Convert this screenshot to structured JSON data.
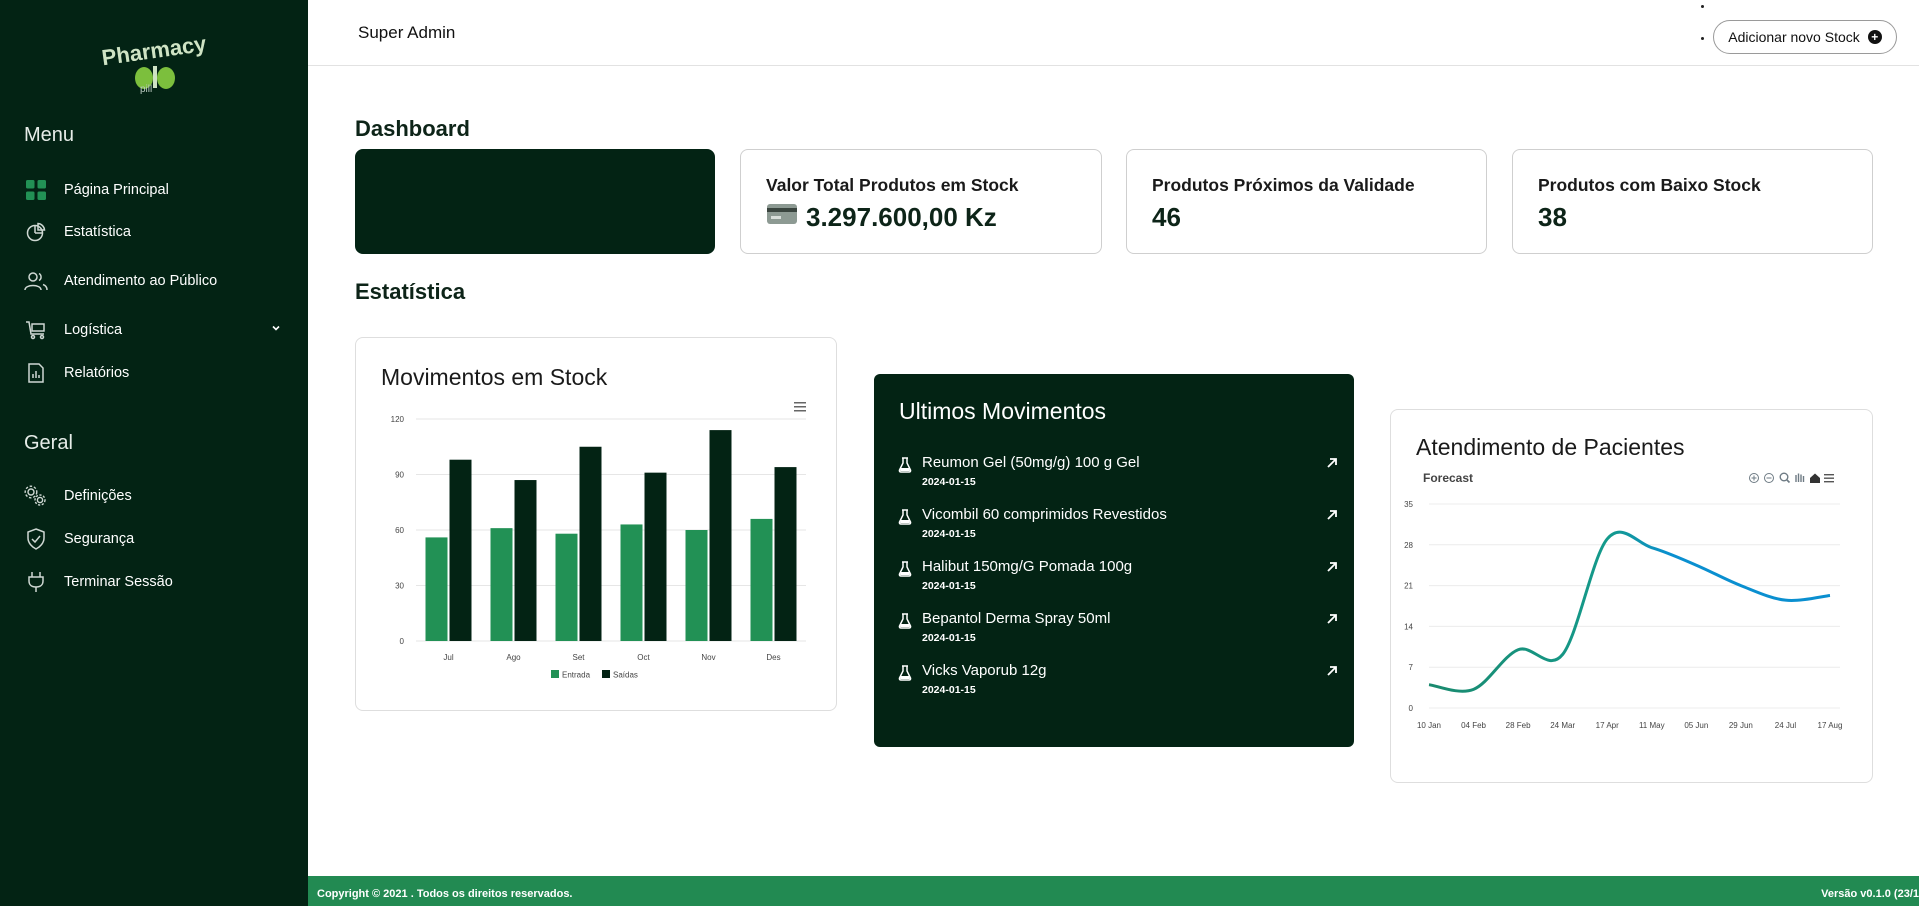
{
  "colors": {
    "sidebar_bg": "#032314",
    "accent_green": "#228a52",
    "bar_entrada": "#229155",
    "bar_saidas": "#032314",
    "line": "#0a8fd0",
    "link": "#0d8ff0"
  },
  "sidebar": {
    "logo_text": "Pharmacy",
    "logo_sub": "pill",
    "menu_title": "Menu",
    "menu_items": [
      {
        "label": "Página Principal",
        "icon": "grid-icon"
      },
      {
        "label": "Estatística",
        "icon": "pie-chart-icon"
      },
      {
        "label": "Atendimento ao Público",
        "icon": "users-icon"
      },
      {
        "label": "Logística",
        "icon": "cart-icon",
        "has_submenu": true
      },
      {
        "label": "Relatórios",
        "icon": "report-icon"
      }
    ],
    "general_title": "Geral",
    "general_items": [
      {
        "label": "Definições",
        "icon": "gears-icon"
      },
      {
        "label": "Segurança",
        "icon": "shield-icon"
      },
      {
        "label": "Terminar Sessão",
        "icon": "plug-icon"
      }
    ]
  },
  "topbar": {
    "user": "Super Admin",
    "add_stock_label": "Adicionar novo Stock"
  },
  "dashboard": {
    "title": "Dashboard",
    "cards": [
      {
        "label": "Valor Total Produtos em Stock",
        "value": "3.297.600,00 Kz",
        "icon": "credit-card-icon"
      },
      {
        "label": "Produtos Próximos da Validade",
        "value": "46"
      },
      {
        "label": "Produtos com Baixo Stock",
        "value": "38"
      }
    ]
  },
  "stats": {
    "title": "Estatística",
    "stock_chart_title": "Movimentos em Stock",
    "last_moves_title": "Ultimos Movimentos",
    "patients_title": "Atendimento de Pacientes"
  },
  "last_moves": [
    {
      "name": "Reumon Gel (50mg/g) 100 g Gel",
      "date": "2024-01-15"
    },
    {
      "name": "Vicombil 60 comprimidos Revestidos",
      "date": "2024-01-15"
    },
    {
      "name": "Halibut 150mg/G Pomada 100g",
      "date": "2024-01-15"
    },
    {
      "name": "Bepantol Derma Spray 50ml",
      "date": "2024-01-15"
    },
    {
      "name": "Vicks Vaporub 12g",
      "date": "2024-01-15"
    }
  ],
  "chart_data": [
    {
      "type": "bar",
      "title": "Movimentos em Stock",
      "categories": [
        "Jul",
        "Ago",
        "Set",
        "Oct",
        "Nov",
        "Des"
      ],
      "series": [
        {
          "name": "Entrada",
          "values": [
            56,
            61,
            58,
            63,
            60,
            66
          ]
        },
        {
          "name": "Saídas",
          "values": [
            98,
            87,
            105,
            91,
            114,
            94
          ]
        }
      ],
      "yticks": [
        0,
        30,
        60,
        90,
        120
      ],
      "ylim": [
        0,
        120
      ],
      "grid": true,
      "legend": "bottom"
    },
    {
      "type": "line",
      "title": "Atendimento de Pacientes",
      "subtitle": "Forecast",
      "x": [
        "10 Jan",
        "04 Feb",
        "28 Feb",
        "24 Mar",
        "17 Apr",
        "11 May",
        "05 Jun",
        "29 Jun",
        "24 Jul",
        "17 Aug"
      ],
      "series": [
        {
          "values": [
            4,
            3.2,
            10,
            9.2,
            29,
            27.5,
            24.5,
            21,
            18.5,
            19.3
          ]
        }
      ],
      "yticks": [
        0,
        7,
        14,
        21,
        28,
        35
      ],
      "ylim": [
        0,
        35
      ],
      "grid": true,
      "toolbar_icons": [
        "zoom-in-icon",
        "zoom-out-icon",
        "search-icon",
        "pan-hand-icon",
        "home-icon",
        "menu-icon"
      ]
    }
  ],
  "footer": {
    "copyright_prefix": "Copyright © 2021",
    "copyright_suffix": ". Todos os direitos reservados.",
    "version_text": "Versão v0.1.0 (23/1"
  }
}
